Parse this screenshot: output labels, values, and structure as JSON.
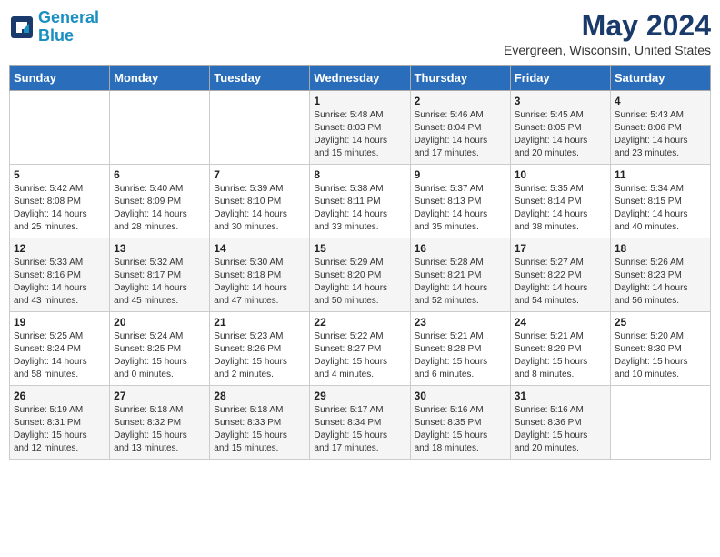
{
  "header": {
    "logo_line1": "General",
    "logo_line2": "Blue",
    "month_year": "May 2024",
    "location": "Evergreen, Wisconsin, United States"
  },
  "weekdays": [
    "Sunday",
    "Monday",
    "Tuesday",
    "Wednesday",
    "Thursday",
    "Friday",
    "Saturday"
  ],
  "weeks": [
    [
      {
        "day": "",
        "info": ""
      },
      {
        "day": "",
        "info": ""
      },
      {
        "day": "",
        "info": ""
      },
      {
        "day": "1",
        "info": "Sunrise: 5:48 AM\nSunset: 8:03 PM\nDaylight: 14 hours\nand 15 minutes."
      },
      {
        "day": "2",
        "info": "Sunrise: 5:46 AM\nSunset: 8:04 PM\nDaylight: 14 hours\nand 17 minutes."
      },
      {
        "day": "3",
        "info": "Sunrise: 5:45 AM\nSunset: 8:05 PM\nDaylight: 14 hours\nand 20 minutes."
      },
      {
        "day": "4",
        "info": "Sunrise: 5:43 AM\nSunset: 8:06 PM\nDaylight: 14 hours\nand 23 minutes."
      }
    ],
    [
      {
        "day": "5",
        "info": "Sunrise: 5:42 AM\nSunset: 8:08 PM\nDaylight: 14 hours\nand 25 minutes."
      },
      {
        "day": "6",
        "info": "Sunrise: 5:40 AM\nSunset: 8:09 PM\nDaylight: 14 hours\nand 28 minutes."
      },
      {
        "day": "7",
        "info": "Sunrise: 5:39 AM\nSunset: 8:10 PM\nDaylight: 14 hours\nand 30 minutes."
      },
      {
        "day": "8",
        "info": "Sunrise: 5:38 AM\nSunset: 8:11 PM\nDaylight: 14 hours\nand 33 minutes."
      },
      {
        "day": "9",
        "info": "Sunrise: 5:37 AM\nSunset: 8:13 PM\nDaylight: 14 hours\nand 35 minutes."
      },
      {
        "day": "10",
        "info": "Sunrise: 5:35 AM\nSunset: 8:14 PM\nDaylight: 14 hours\nand 38 minutes."
      },
      {
        "day": "11",
        "info": "Sunrise: 5:34 AM\nSunset: 8:15 PM\nDaylight: 14 hours\nand 40 minutes."
      }
    ],
    [
      {
        "day": "12",
        "info": "Sunrise: 5:33 AM\nSunset: 8:16 PM\nDaylight: 14 hours\nand 43 minutes."
      },
      {
        "day": "13",
        "info": "Sunrise: 5:32 AM\nSunset: 8:17 PM\nDaylight: 14 hours\nand 45 minutes."
      },
      {
        "day": "14",
        "info": "Sunrise: 5:30 AM\nSunset: 8:18 PM\nDaylight: 14 hours\nand 47 minutes."
      },
      {
        "day": "15",
        "info": "Sunrise: 5:29 AM\nSunset: 8:20 PM\nDaylight: 14 hours\nand 50 minutes."
      },
      {
        "day": "16",
        "info": "Sunrise: 5:28 AM\nSunset: 8:21 PM\nDaylight: 14 hours\nand 52 minutes."
      },
      {
        "day": "17",
        "info": "Sunrise: 5:27 AM\nSunset: 8:22 PM\nDaylight: 14 hours\nand 54 minutes."
      },
      {
        "day": "18",
        "info": "Sunrise: 5:26 AM\nSunset: 8:23 PM\nDaylight: 14 hours\nand 56 minutes."
      }
    ],
    [
      {
        "day": "19",
        "info": "Sunrise: 5:25 AM\nSunset: 8:24 PM\nDaylight: 14 hours\nand 58 minutes."
      },
      {
        "day": "20",
        "info": "Sunrise: 5:24 AM\nSunset: 8:25 PM\nDaylight: 15 hours\nand 0 minutes."
      },
      {
        "day": "21",
        "info": "Sunrise: 5:23 AM\nSunset: 8:26 PM\nDaylight: 15 hours\nand 2 minutes."
      },
      {
        "day": "22",
        "info": "Sunrise: 5:22 AM\nSunset: 8:27 PM\nDaylight: 15 hours\nand 4 minutes."
      },
      {
        "day": "23",
        "info": "Sunrise: 5:21 AM\nSunset: 8:28 PM\nDaylight: 15 hours\nand 6 minutes."
      },
      {
        "day": "24",
        "info": "Sunrise: 5:21 AM\nSunset: 8:29 PM\nDaylight: 15 hours\nand 8 minutes."
      },
      {
        "day": "25",
        "info": "Sunrise: 5:20 AM\nSunset: 8:30 PM\nDaylight: 15 hours\nand 10 minutes."
      }
    ],
    [
      {
        "day": "26",
        "info": "Sunrise: 5:19 AM\nSunset: 8:31 PM\nDaylight: 15 hours\nand 12 minutes."
      },
      {
        "day": "27",
        "info": "Sunrise: 5:18 AM\nSunset: 8:32 PM\nDaylight: 15 hours\nand 13 minutes."
      },
      {
        "day": "28",
        "info": "Sunrise: 5:18 AM\nSunset: 8:33 PM\nDaylight: 15 hours\nand 15 minutes."
      },
      {
        "day": "29",
        "info": "Sunrise: 5:17 AM\nSunset: 8:34 PM\nDaylight: 15 hours\nand 17 minutes."
      },
      {
        "day": "30",
        "info": "Sunrise: 5:16 AM\nSunset: 8:35 PM\nDaylight: 15 hours\nand 18 minutes."
      },
      {
        "day": "31",
        "info": "Sunrise: 5:16 AM\nSunset: 8:36 PM\nDaylight: 15 hours\nand 20 minutes."
      },
      {
        "day": "",
        "info": ""
      }
    ]
  ]
}
